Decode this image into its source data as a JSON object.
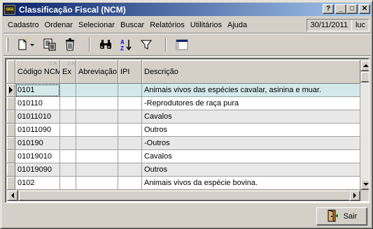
{
  "window": {
    "title": "Classificação Fiscal (NCM)",
    "icon_text": "SIGE",
    "controls": {
      "help": "?",
      "minimize": "_",
      "maximize": "□",
      "close": "✕"
    }
  },
  "menu": {
    "items": [
      {
        "label": "Cadastro"
      },
      {
        "label": "Ordenar"
      },
      {
        "label": "Selecionar"
      },
      {
        "label": "Buscar"
      },
      {
        "label": "Relatórios"
      },
      {
        "label": "Utilitários"
      },
      {
        "label": "Ajuda"
      }
    ],
    "date": "30/11/2011",
    "user": "luc"
  },
  "toolbar": {
    "icons": [
      "new-record-icon",
      "edit-record-icon",
      "delete-icon",
      "search-binoculars-icon",
      "sort-az-icon",
      "filter-icon",
      "layout-icon"
    ]
  },
  "grid": {
    "columns": [
      {
        "label": "Código NCM",
        "sort": "1 A"
      },
      {
        "label": "Ex",
        "sort": "2 A"
      },
      {
        "label": "Abreviação",
        "sort": ""
      },
      {
        "label": "IPI",
        "sort": ""
      },
      {
        "label": "Descrição",
        "sort": ""
      }
    ],
    "rows": [
      {
        "codigo": "0101",
        "ex": "",
        "abreviacao": "",
        "ipi": "",
        "descricao": "Animais vivos das espécies cavalar, asinina e muar."
      },
      {
        "codigo": "010110",
        "ex": "",
        "abreviacao": "",
        "ipi": "",
        "descricao": "-Reprodutores de raça pura"
      },
      {
        "codigo": "01011010",
        "ex": "",
        "abreviacao": "",
        "ipi": "",
        "descricao": "Cavalos"
      },
      {
        "codigo": "01011090",
        "ex": "",
        "abreviacao": "",
        "ipi": "",
        "descricao": "Outros"
      },
      {
        "codigo": "010190",
        "ex": "",
        "abreviacao": "",
        "ipi": "",
        "descricao": "-Outros"
      },
      {
        "codigo": "01019010",
        "ex": "",
        "abreviacao": "",
        "ipi": "",
        "descricao": "Cavalos"
      },
      {
        "codigo": "01019090",
        "ex": "",
        "abreviacao": "",
        "ipi": "",
        "descricao": "Outros"
      },
      {
        "codigo": "0102",
        "ex": "",
        "abreviacao": "",
        "ipi": "",
        "descricao": "Animais vivos da espécie bovina."
      }
    ]
  },
  "footer": {
    "exit_label": "Sair"
  },
  "colors": {
    "title_start": "#0a246a",
    "title_end": "#a6caf0",
    "selected_row": "#d3e9ec",
    "alt_row": "#e8e8e8",
    "face": "#d4d0c8"
  }
}
